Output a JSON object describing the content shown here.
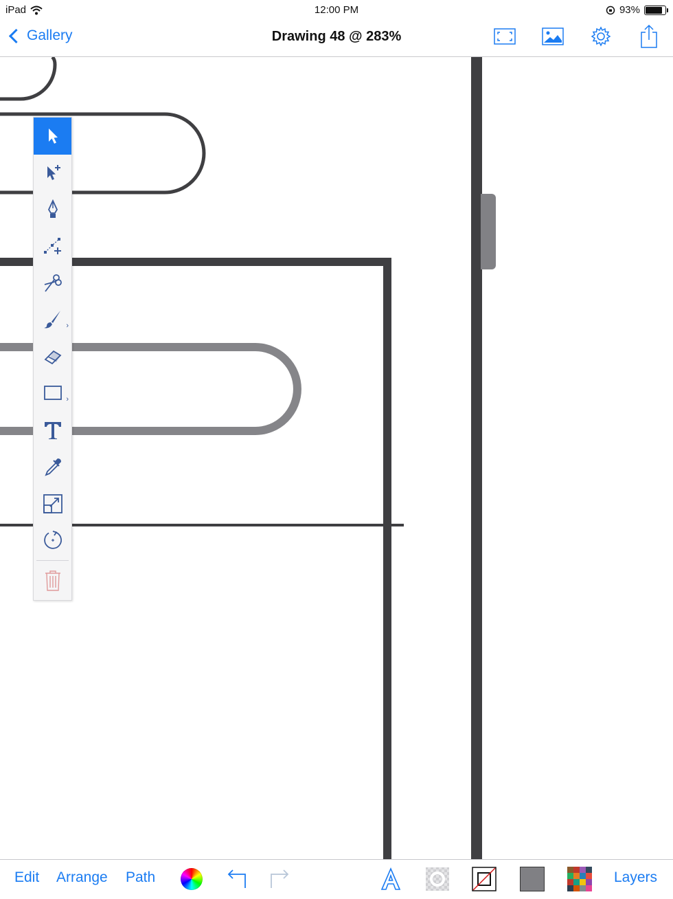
{
  "status": {
    "device": "iPad",
    "time": "12:00 PM",
    "battery": "93%"
  },
  "nav": {
    "back_label": "Gallery",
    "title": "Drawing 48 @ 283%"
  },
  "toolbar": {
    "edit_label": "Edit",
    "arrange_label": "Arrange",
    "path_label": "Path",
    "layers_label": "Layers"
  },
  "tools": [
    {
      "name": "select",
      "icon": "arrow-pointer-icon",
      "active": true
    },
    {
      "name": "subselect",
      "icon": "add-pointer-icon"
    },
    {
      "name": "pen",
      "icon": "pen-nib-icon"
    },
    {
      "name": "add-point",
      "icon": "add-anchor-point-icon"
    },
    {
      "name": "scissors",
      "icon": "scissors-icon"
    },
    {
      "name": "brush",
      "icon": "paintbrush-icon"
    },
    {
      "name": "eraser",
      "icon": "eraser-icon"
    },
    {
      "name": "shape",
      "icon": "rectangle-icon"
    },
    {
      "name": "text",
      "icon": "text-icon"
    },
    {
      "name": "eyedropper",
      "icon": "eyedropper-icon"
    },
    {
      "name": "scale",
      "icon": "scale-icon"
    },
    {
      "name": "rotate",
      "icon": "rotate-icon"
    },
    {
      "name": "delete",
      "icon": "trash-icon"
    }
  ],
  "colors": {
    "accent": "#1b7cf2",
    "stroke_dark": "#3f3f42",
    "stroke_gray": "#858589",
    "fill_swatch": "#808084",
    "trash": "#e09a9a"
  }
}
